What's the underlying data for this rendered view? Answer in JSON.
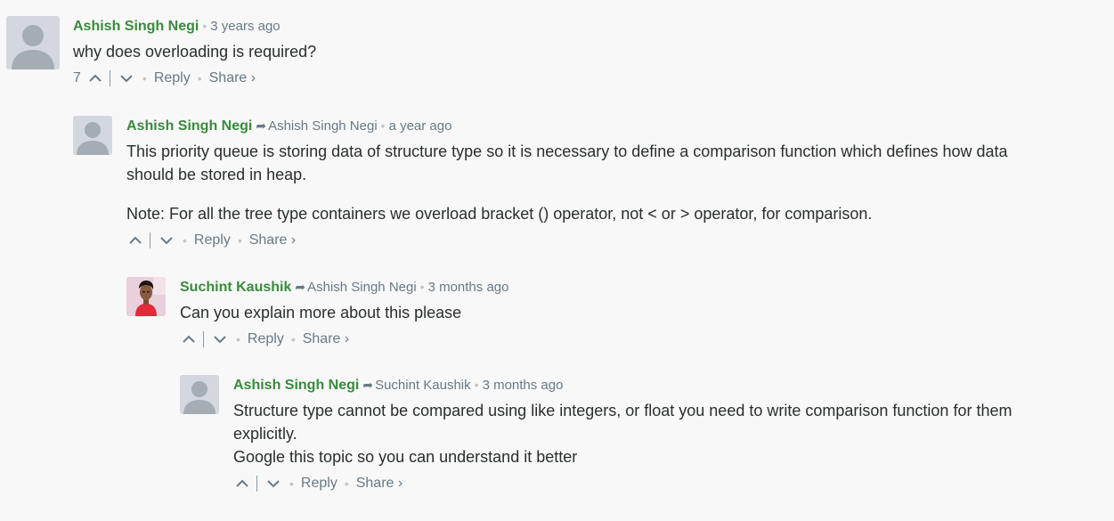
{
  "comments": [
    {
      "author": "Ashish Singh Negi",
      "parent": "",
      "time": "3 years ago",
      "paragraphs": [
        "why does overloading is required?"
      ],
      "votes": "7",
      "reply": "Reply",
      "share": "Share ›"
    },
    {
      "author": "Ashish Singh Negi",
      "parent": "Ashish Singh Negi",
      "time": "a year ago",
      "paragraphs": [
        "This priority queue is storing data of structure type so it is necessary to define a comparison function which defines how data should be stored in heap.",
        "Note: For all the tree type containers we overload bracket () operator, not < or > operator, for comparison."
      ],
      "votes": "",
      "reply": "Reply",
      "share": "Share ›"
    },
    {
      "author": "Suchint Kaushik",
      "parent": "Ashish Singh Negi",
      "time": "3 months ago",
      "paragraphs": [
        "Can you explain more about this please"
      ],
      "votes": "",
      "reply": "Reply",
      "share": "Share ›"
    },
    {
      "author": "Ashish Singh Negi",
      "parent": "Suchint Kaushik",
      "time": "3 months ago",
      "paragraphs": [
        "Structure type cannot be compared using like integers, or float you need to write comparison function for them explicitly.",
        "Google this topic so you can understand it better"
      ],
      "votes": "",
      "reply": "Reply",
      "share": "Share ›"
    }
  ],
  "colors": {
    "author": "#3a8a3e",
    "meta": "#687a86",
    "text": "#2a2e2e",
    "background": "#f8f8f8"
  },
  "icons": {
    "upvote": "chevron-up-icon",
    "downvote": "chevron-down-icon",
    "reply_arrow": "reply-arrow-icon",
    "default_avatar": "user-silhouette-icon"
  }
}
